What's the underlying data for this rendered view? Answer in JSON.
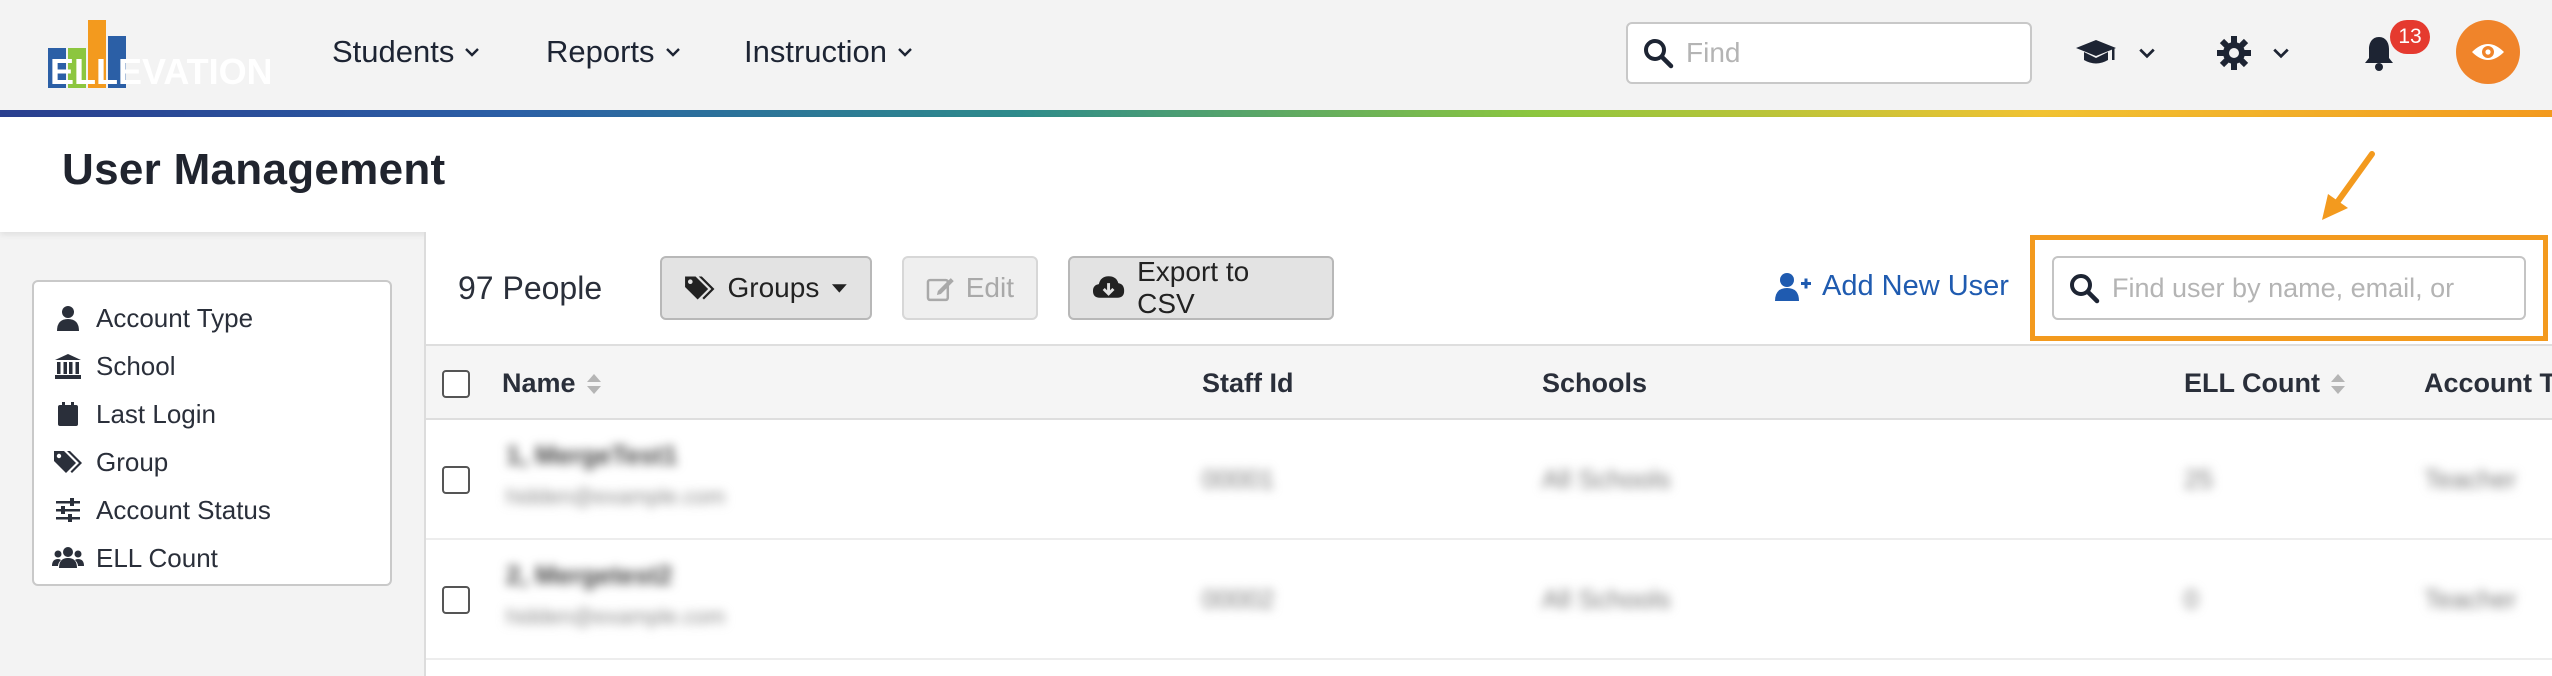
{
  "app": {
    "logo_text": "ELLEVATION",
    "brand_orange": "#f39a1e",
    "brand_blue": "#2b5fa6",
    "accent_link": "#1f5bb0"
  },
  "nav": {
    "items": [
      {
        "label": "Students",
        "icon": "chevron-down-icon"
      },
      {
        "label": "Reports",
        "icon": "chevron-down-icon"
      },
      {
        "label": "Instruction",
        "icon": "chevron-down-icon"
      }
    ],
    "search_placeholder": "Find",
    "notifications_count": "13"
  },
  "page": {
    "title": "User Management"
  },
  "filters": [
    {
      "label": "Account Type",
      "icon": "user-icon"
    },
    {
      "label": "School",
      "icon": "school-icon"
    },
    {
      "label": "Last Login",
      "icon": "calendar-icon"
    },
    {
      "label": "Group",
      "icon": "tags-icon"
    },
    {
      "label": "Account Status",
      "icon": "sliders-icon"
    },
    {
      "label": "ELL Count",
      "icon": "users-icon"
    }
  ],
  "toolbar": {
    "people_count": "97 People",
    "groups_label": "Groups",
    "edit_label": "Edit",
    "export_label": "Export to CSV",
    "add_user_label": "Add New User",
    "user_search_placeholder": "Find user by name, email, or"
  },
  "table": {
    "columns": [
      "Name",
      "Staff Id",
      "Schools",
      "ELL Count",
      "Account Type"
    ],
    "rows": [
      {
        "name": "1, MergeTest1",
        "email": "hidden@example.com",
        "staff_id": "00001",
        "schools": "All Schools",
        "ell_count": "25",
        "account_type": "Teacher"
      },
      {
        "name": "2, Mergetest2",
        "email": "hidden@example.com",
        "staff_id": "00002",
        "schools": "All Schools",
        "ell_count": "0",
        "account_type": "Teacher"
      }
    ]
  }
}
